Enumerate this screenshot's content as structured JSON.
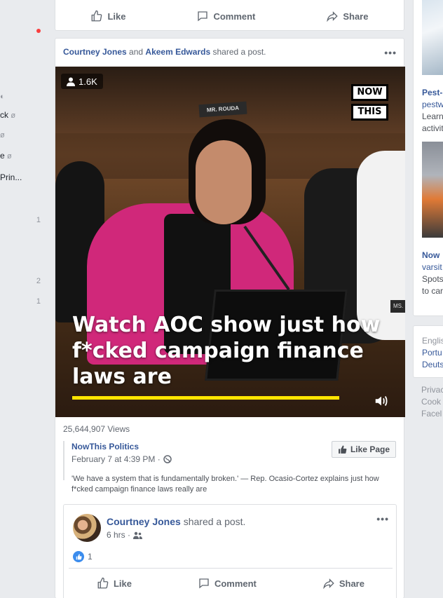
{
  "left_sidebar": {
    "items": [
      {
        "label": "ck",
        "hidden": true
      },
      {
        "label": "",
        "hidden": true
      },
      {
        "label": "e",
        "hidden": true
      },
      {
        "label": "Prin...",
        "hidden": false
      }
    ],
    "counts": [
      "1",
      "2",
      "1"
    ]
  },
  "previous_post": {
    "actions": {
      "like": "Like",
      "comment": "Comment",
      "share": "Share"
    }
  },
  "post": {
    "actor1": "Courtney Jones",
    "connector": "and",
    "actor2": "Akeem Edwards",
    "verb": "shared a post.",
    "video": {
      "viewers": "1.6K",
      "brand_line1": "NOW",
      "brand_line2": "THIS",
      "nameplate": "MR. ROUDA",
      "nameplate2": "MS.",
      "headline": "Watch AOC show just how f*cked campaign finance laws are"
    },
    "views": "25,644,907 Views",
    "source_page": "NowThis Politics",
    "source_date": "February 7 at 4:39 PM ·",
    "like_page_label": "Like Page",
    "caption": "'We have a system that is fundamentally broken.' — Rep. Ocasio-Cortez explains just how f*cked campaign finance laws really are"
  },
  "inner_post": {
    "author": "Courtney Jones",
    "verb": "shared a post.",
    "time": "6 hrs ·",
    "reaction_count": "1",
    "actions": {
      "like": "Like",
      "comment": "Comment",
      "share": "Share"
    }
  },
  "right_column": {
    "ad1_title": "Pest-",
    "ad1_url": "pestw",
    "ad1_line1": "Learn",
    "ad1_line2": "activit",
    "ad2_title": "Now",
    "ad2_url": "varsit",
    "ad2_line1": "Spots",
    "ad2_line2": "to car",
    "languages": [
      "Englis",
      "Portu",
      "Deuts"
    ],
    "footer": [
      "Privac",
      "Cook",
      "Facel"
    ]
  },
  "colors": {
    "link": "#365899",
    "brand_pink": "#d0287a",
    "highlight_yellow": "#ffe500",
    "like_blue": "#3b8ced"
  }
}
